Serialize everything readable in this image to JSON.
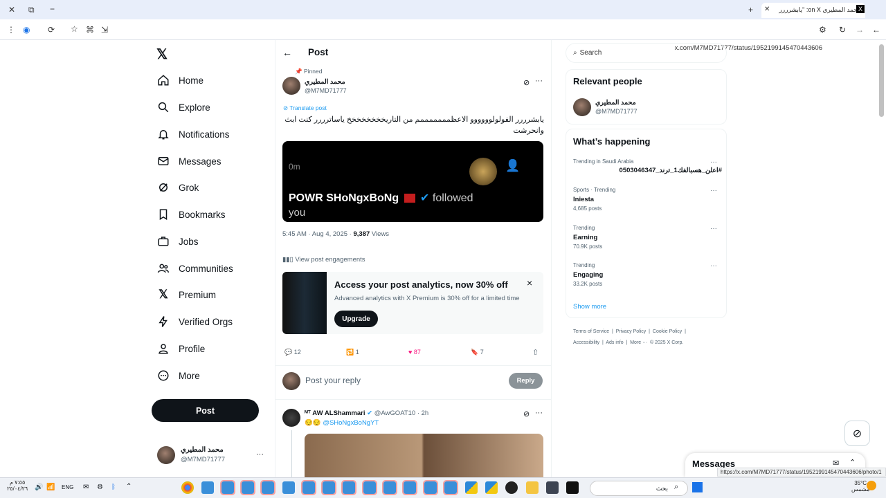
{
  "browser": {
    "tab_title": "محمد المطيري on X: \"يابشرررر",
    "url": "x.com/M7MD71777/status/1952199145470443606",
    "status_url": "https://x.com/M7MD71777/status/1952199145470443606/photo/1"
  },
  "nav": {
    "items": [
      "Home",
      "Explore",
      "Notifications",
      "Messages",
      "Grok",
      "Bookmarks",
      "Jobs",
      "Communities",
      "Premium",
      "Verified Orgs",
      "Profile",
      "More"
    ],
    "post_button": "Post",
    "account_name": "محمد المطيري",
    "account_handle": "@M7MD71777",
    "account_more": "···"
  },
  "header": {
    "title": "Post",
    "back": "←"
  },
  "tweet": {
    "pinned": "Pinned",
    "name": "محمد المطيري",
    "handle": "@M7MD71777",
    "translate": "Translate post",
    "text": "يابشرررر الفولولوووووو الاعظمممممممم من التاريخخخخخخخخ ياساترررر كنت ابث وانحرشت",
    "media_time": "0m",
    "media_name": "POWR SHoNgxBoNg",
    "media_followed": "followed",
    "media_you": "you",
    "time": "5:45 AM · Aug 4, 2025 · ",
    "views_count": "9,387",
    "views_label": " Views",
    "engagements": "View post engagements",
    "more": "···"
  },
  "promo": {
    "title": "Access your post analytics, now 30% off",
    "subtitle": "Advanced analytics with X Premium is 30% off for a limited time",
    "button": "Upgrade",
    "close": "×"
  },
  "actions": {
    "replies": "12",
    "reposts": "1",
    "likes": "87",
    "bookmarks": "7"
  },
  "reply_box": {
    "placeholder": "Post your reply",
    "button": "Reply"
  },
  "reply": {
    "name": "ᴹᵀ AW ALShammari",
    "handle": "@AwGOAT10 · 2h",
    "text_emoji": "😔😔",
    "mention": "@SHoNgxBoNgYT",
    "more": "···"
  },
  "right": {
    "search_placeholder": "Search",
    "relevant_title": "Relevant people",
    "person_name": "محمد المطيري",
    "person_handle": "@M7MD71777",
    "happening_title": "What’s happening",
    "trends": [
      {
        "context": "Trending in Saudi Arabia",
        "name": "#اعلن_هسبالفك1_ترند_0503046347",
        "posts": ""
      },
      {
        "context": "Sports · Trending",
        "name": "Iniesta",
        "posts": "4,685 posts"
      },
      {
        "context": "Trending",
        "name": "Earning",
        "posts": "70.9K posts"
      },
      {
        "context": "Trending",
        "name": "Engaging",
        "posts": "33.2K posts"
      }
    ],
    "show_more": "Show more",
    "footer_line1": "Terms of Service  |  Privacy Policy  |  Cookie Policy  |",
    "footer_line2": "Accessibility  |  Ads info  |  More ···  © 2025 X Corp.",
    "messages_label": "Messages"
  },
  "taskbar": {
    "time": "٧:٥٥ م",
    "date": "٢٥/٠٤/٢٦",
    "lang": "ENG",
    "weather": "35°C",
    "weather_desc": "مشمس",
    "search": "بحث"
  }
}
